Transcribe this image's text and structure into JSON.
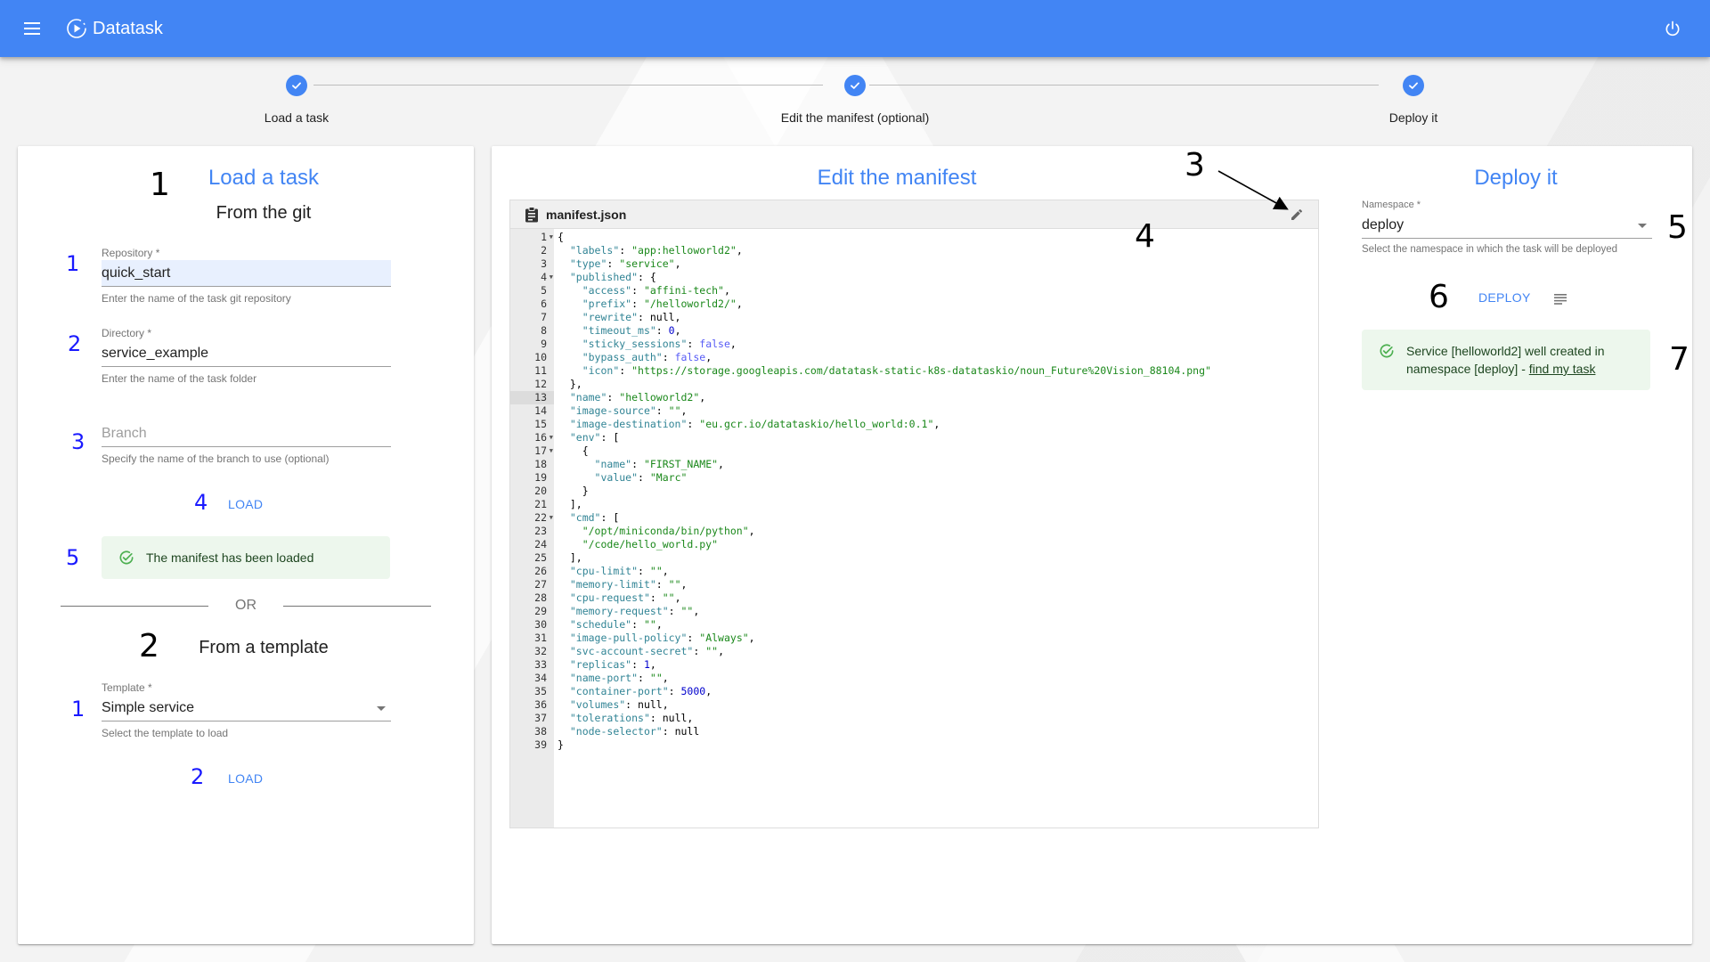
{
  "app": {
    "title": "Datatask",
    "menu_icon": "menu-icon",
    "logo_icon": "play-circle-icon",
    "power_icon": "power-icon"
  },
  "stepper": {
    "steps": [
      {
        "label": "Load a task",
        "status": "complete"
      },
      {
        "label": "Edit the manifest (optional)",
        "status": "complete"
      },
      {
        "label": "Deploy it",
        "status": "complete"
      }
    ]
  },
  "load_panel": {
    "title": "Load a task",
    "git_subtitle": "From the git",
    "repository": {
      "label": "Repository *",
      "value": "quick_start",
      "hint": "Enter the name of the task git repository"
    },
    "directory": {
      "label": "Directory *",
      "value": "service_example",
      "hint": "Enter the name of the task folder"
    },
    "branch": {
      "placeholder": "Branch",
      "value": "",
      "hint": "Specify the name of the branch to use (optional)"
    },
    "load_label": "LOAD",
    "success_message": "The manifest has been loaded",
    "or_label": "OR",
    "template_subtitle": "From a template",
    "template": {
      "label": "Template *",
      "value": "Simple service",
      "hint": "Select the template to load"
    },
    "template_load_label": "LOAD"
  },
  "editor_panel": {
    "title": "Edit the manifest",
    "filename": "manifest.json",
    "active_line": 13,
    "fold_lines": [
      1,
      4,
      16,
      17,
      22
    ],
    "lines": [
      [
        [
          "p",
          "{"
        ]
      ],
      [
        [
          "p",
          "  "
        ],
        [
          "k",
          "\"labels\""
        ],
        [
          "p",
          ": "
        ],
        [
          "s",
          "\"app:helloworld2\""
        ],
        [
          "p",
          ","
        ]
      ],
      [
        [
          "p",
          "  "
        ],
        [
          "k",
          "\"type\""
        ],
        [
          "p",
          ": "
        ],
        [
          "s",
          "\"service\""
        ],
        [
          "p",
          ","
        ]
      ],
      [
        [
          "p",
          "  "
        ],
        [
          "k",
          "\"published\""
        ],
        [
          "p",
          ": {"
        ]
      ],
      [
        [
          "p",
          "    "
        ],
        [
          "k",
          "\"access\""
        ],
        [
          "p",
          ": "
        ],
        [
          "s",
          "\"affini-tech\""
        ],
        [
          "p",
          ","
        ]
      ],
      [
        [
          "p",
          "    "
        ],
        [
          "k",
          "\"prefix\""
        ],
        [
          "p",
          ": "
        ],
        [
          "s",
          "\"/helloworld2/\""
        ],
        [
          "p",
          ","
        ]
      ],
      [
        [
          "p",
          "    "
        ],
        [
          "k",
          "\"rewrite\""
        ],
        [
          "p",
          ": null,"
        ]
      ],
      [
        [
          "p",
          "    "
        ],
        [
          "k",
          "\"timeout_ms\""
        ],
        [
          "p",
          ": "
        ],
        [
          "n",
          "0"
        ],
        [
          "p",
          ","
        ]
      ],
      [
        [
          "p",
          "    "
        ],
        [
          "k",
          "\"sticky_sessions\""
        ],
        [
          "p",
          ": "
        ],
        [
          "b",
          "false"
        ],
        [
          "p",
          ","
        ]
      ],
      [
        [
          "p",
          "    "
        ],
        [
          "k",
          "\"bypass_auth\""
        ],
        [
          "p",
          ": "
        ],
        [
          "b",
          "false"
        ],
        [
          "p",
          ","
        ]
      ],
      [
        [
          "p",
          "    "
        ],
        [
          "k",
          "\"icon\""
        ],
        [
          "p",
          ": "
        ],
        [
          "s",
          "\"https://storage.googleapis.com/datatask-static-k8s-datataskio/noun_Future%20Vision_88104.png\""
        ]
      ],
      [
        [
          "p",
          "  },"
        ]
      ],
      [
        [
          "p",
          "  "
        ],
        [
          "k",
          "\"name\""
        ],
        [
          "p",
          ": "
        ],
        [
          "s",
          "\"helloworld2\""
        ],
        [
          "p",
          ","
        ]
      ],
      [
        [
          "p",
          "  "
        ],
        [
          "k",
          "\"image-source\""
        ],
        [
          "p",
          ": "
        ],
        [
          "s",
          "\"\""
        ],
        [
          "p",
          ","
        ]
      ],
      [
        [
          "p",
          "  "
        ],
        [
          "k",
          "\"image-destination\""
        ],
        [
          "p",
          ": "
        ],
        [
          "s",
          "\"eu.gcr.io/datataskio/hello_world:0.1\""
        ],
        [
          "p",
          ","
        ]
      ],
      [
        [
          "p",
          "  "
        ],
        [
          "k",
          "\"env\""
        ],
        [
          "p",
          ": ["
        ]
      ],
      [
        [
          "p",
          "    {"
        ]
      ],
      [
        [
          "p",
          "      "
        ],
        [
          "k",
          "\"name\""
        ],
        [
          "p",
          ": "
        ],
        [
          "s",
          "\"FIRST_NAME\""
        ],
        [
          "p",
          ","
        ]
      ],
      [
        [
          "p",
          "      "
        ],
        [
          "k",
          "\"value\""
        ],
        [
          "p",
          ": "
        ],
        [
          "s",
          "\"Marc\""
        ]
      ],
      [
        [
          "p",
          "    }"
        ]
      ],
      [
        [
          "p",
          "  ],"
        ]
      ],
      [
        [
          "p",
          "  "
        ],
        [
          "k",
          "\"cmd\""
        ],
        [
          "p",
          ": ["
        ]
      ],
      [
        [
          "p",
          "    "
        ],
        [
          "s",
          "\"/opt/miniconda/bin/python\""
        ],
        [
          "p",
          ","
        ]
      ],
      [
        [
          "p",
          "    "
        ],
        [
          "s",
          "\"/code/hello_world.py\""
        ]
      ],
      [
        [
          "p",
          "  ],"
        ]
      ],
      [
        [
          "p",
          "  "
        ],
        [
          "k",
          "\"cpu-limit\""
        ],
        [
          "p",
          ": "
        ],
        [
          "s",
          "\"\""
        ],
        [
          "p",
          ","
        ]
      ],
      [
        [
          "p",
          "  "
        ],
        [
          "k",
          "\"memory-limit\""
        ],
        [
          "p",
          ": "
        ],
        [
          "s",
          "\"\""
        ],
        [
          "p",
          ","
        ]
      ],
      [
        [
          "p",
          "  "
        ],
        [
          "k",
          "\"cpu-request\""
        ],
        [
          "p",
          ": "
        ],
        [
          "s",
          "\"\""
        ],
        [
          "p",
          ","
        ]
      ],
      [
        [
          "p",
          "  "
        ],
        [
          "k",
          "\"memory-request\""
        ],
        [
          "p",
          ": "
        ],
        [
          "s",
          "\"\""
        ],
        [
          "p",
          ","
        ]
      ],
      [
        [
          "p",
          "  "
        ],
        [
          "k",
          "\"schedule\""
        ],
        [
          "p",
          ": "
        ],
        [
          "s",
          "\"\""
        ],
        [
          "p",
          ","
        ]
      ],
      [
        [
          "p",
          "  "
        ],
        [
          "k",
          "\"image-pull-policy\""
        ],
        [
          "p",
          ": "
        ],
        [
          "s",
          "\"Always\""
        ],
        [
          "p",
          ","
        ]
      ],
      [
        [
          "p",
          "  "
        ],
        [
          "k",
          "\"svc-account-secret\""
        ],
        [
          "p",
          ": "
        ],
        [
          "s",
          "\"\""
        ],
        [
          "p",
          ","
        ]
      ],
      [
        [
          "p",
          "  "
        ],
        [
          "k",
          "\"replicas\""
        ],
        [
          "p",
          ": "
        ],
        [
          "n",
          "1"
        ],
        [
          "p",
          ","
        ]
      ],
      [
        [
          "p",
          "  "
        ],
        [
          "k",
          "\"name-port\""
        ],
        [
          "p",
          ": "
        ],
        [
          "s",
          "\"\""
        ],
        [
          "p",
          ","
        ]
      ],
      [
        [
          "p",
          "  "
        ],
        [
          "k",
          "\"container-port\""
        ],
        [
          "p",
          ": "
        ],
        [
          "n",
          "5000"
        ],
        [
          "p",
          ","
        ]
      ],
      [
        [
          "p",
          "  "
        ],
        [
          "k",
          "\"volumes\""
        ],
        [
          "p",
          ": null,"
        ]
      ],
      [
        [
          "p",
          "  "
        ],
        [
          "k",
          "\"tolerations\""
        ],
        [
          "p",
          ": null,"
        ]
      ],
      [
        [
          "p",
          "  "
        ],
        [
          "k",
          "\"node-selector\""
        ],
        [
          "p",
          ": null"
        ]
      ],
      [
        [
          "p",
          "}"
        ]
      ]
    ]
  },
  "deploy_panel": {
    "title": "Deploy it",
    "namespace": {
      "label": "Namespace *",
      "value": "deploy",
      "hint": "Select the namespace in which the task will be deployed"
    },
    "deploy_label": "DEPLOY",
    "logs_icon": "logs-icon",
    "success_message": "Service [helloworld2] well created in namespace [deploy] - ",
    "success_link": "find my task"
  },
  "annotations": {
    "load_section": "1",
    "template_section": "2",
    "repo": "1",
    "dir": "2",
    "branch": "3",
    "load": "4",
    "loaded": "5",
    "template_field": "1",
    "template_load": "2",
    "edit_pencil": "3",
    "editor": "4",
    "namespace": "5",
    "deploy": "6",
    "deploy_result": "7"
  },
  "colors": {
    "primary": "#4285f4",
    "success_bg": "#edf7ed",
    "success_icon": "#4caf50"
  }
}
